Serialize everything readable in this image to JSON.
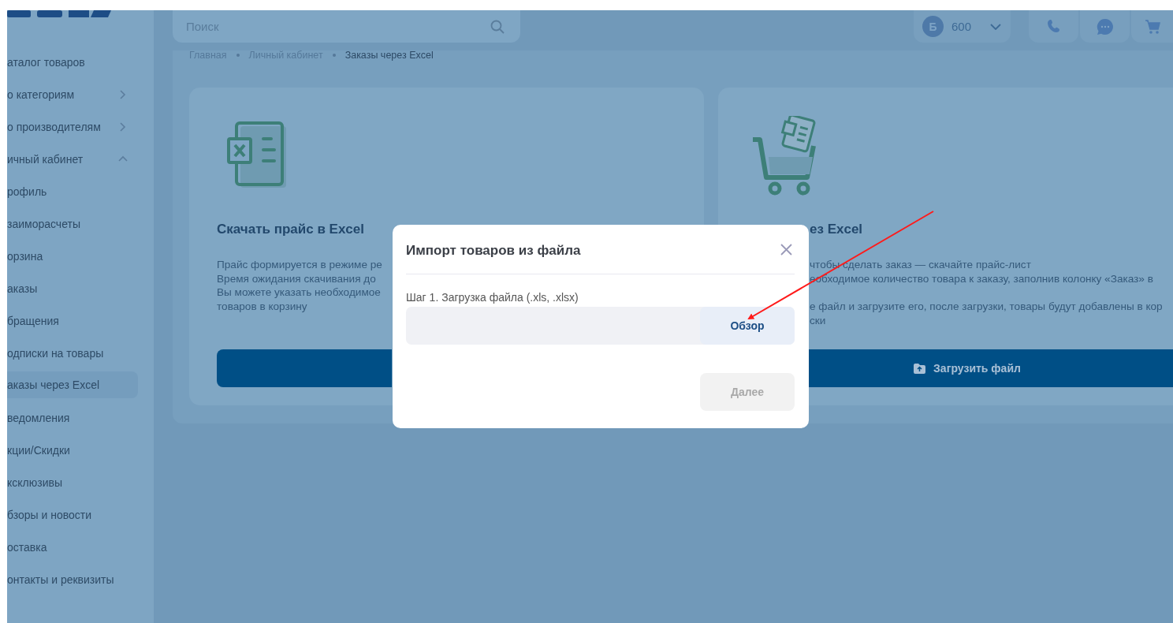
{
  "sidebar": {
    "items": [
      {
        "label": "аталог товаров",
        "selected": false
      },
      {
        "label": "о категориям",
        "selected": false,
        "expanded": false
      },
      {
        "label": "о производителям",
        "selected": false,
        "expanded": false
      },
      {
        "label": "ичный кабинет",
        "selected": false,
        "expanded": true
      },
      {
        "label": "рофиль",
        "selected": false
      },
      {
        "label": "заиморасчеты",
        "selected": false
      },
      {
        "label": "орзина",
        "selected": false
      },
      {
        "label": "аказы",
        "selected": false
      },
      {
        "label": "бращения",
        "selected": false
      },
      {
        "label": "одписки на товары",
        "selected": false
      },
      {
        "label": "аказы через Excel",
        "selected": true
      },
      {
        "label": "ведомления",
        "selected": false
      },
      {
        "label": "кции/Скидки",
        "selected": false
      },
      {
        "label": "ксклюзивы",
        "selected": false
      },
      {
        "label": "бзоры и новости",
        "selected": false
      },
      {
        "label": "оставка",
        "selected": false
      },
      {
        "label": "онтакты и реквизиты",
        "selected": false
      }
    ]
  },
  "header": {
    "search": {
      "placeholder": "Поиск"
    },
    "balance": {
      "badge": "Б",
      "amount": "600"
    }
  },
  "breadcrumbs": [
    "Главная",
    "Личный кабинет",
    "Заказы через Excel"
  ],
  "cards": [
    {
      "kind": "download",
      "title": "Скачать прайс в Excel",
      "paragraphs": [
        [
          "Прайс формируется в режиме ре",
          "Время ожидания скачивания до",
          "Вы можете указать необходимое",
          "товаров в корзину"
        ]
      ]
    },
    {
      "kind": "upload",
      "title": "ез Excel",
      "paragraphs": [
        [
          "чтобы сделать заказ — скачайте прайс-лист",
          "еобходимое количество товара к заказу, заполнив колонку «Заказ» в"
        ],
        [
          "е файл и загрузите его, после загрузки, товары будут добавлены в кор",
          "ски"
        ]
      ],
      "button": "Загрузить файл"
    }
  ],
  "modal": {
    "title": "Импорт товаров из файла",
    "step_label": "Шаг 1. Загрузка файла (.xls, .xlsx)",
    "browse_button": "Обзор",
    "next_button": {
      "label": "Далее",
      "disabled": true
    }
  }
}
